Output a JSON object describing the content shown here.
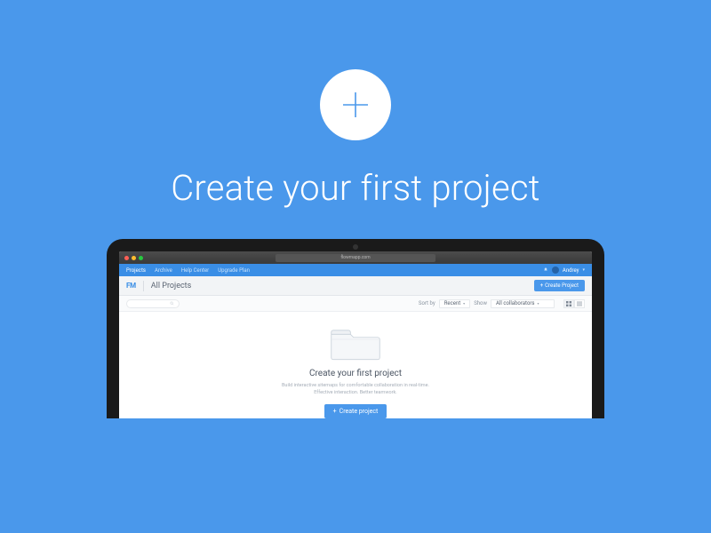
{
  "hero": {
    "title": "Create your first project"
  },
  "browser": {
    "url": "flowmapp.com"
  },
  "nav": {
    "items": [
      "Projects",
      "Archive",
      "Help Center",
      "Upgrade Plan"
    ],
    "user": "Andrey"
  },
  "header": {
    "logo": "FM",
    "title": "All Projects",
    "create_btn": "Create Project"
  },
  "filter": {
    "sort_label": "Sort by",
    "sort_value": "Recent",
    "show_label": "Show",
    "show_value": "All collaborators"
  },
  "empty": {
    "title": "Create your first project",
    "subtitle_line1": "Build interactive sitemaps for comfortable collaboration in real-time.",
    "subtitle_line2": "Effective interaction. Better teamwork.",
    "button": "Create project"
  },
  "colors": {
    "bg": "#4a98eb",
    "accent": "#4a98eb"
  }
}
